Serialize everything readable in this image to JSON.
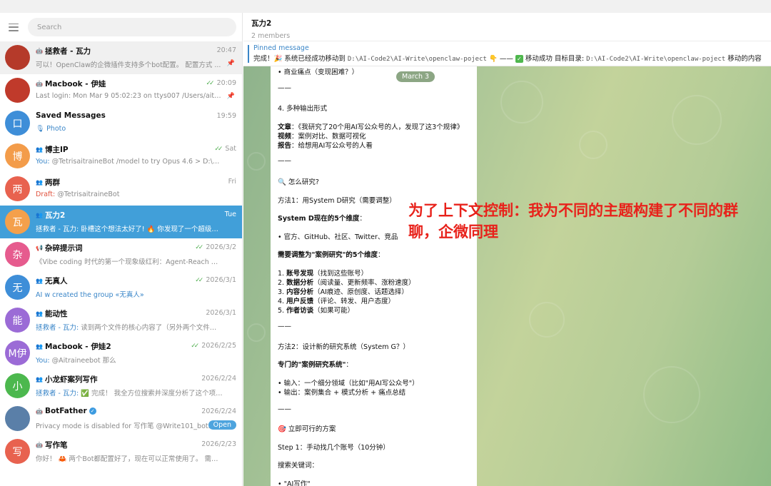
{
  "search": {
    "placeholder": "Search"
  },
  "chats": [
    {
      "name": "拯救者 - 瓦力",
      "time": "20:47",
      "preview": "可以！OpenClaw的企微插件支持多个bot配置。 配置方式 ...",
      "avatar_text": "",
      "avatar_color": "#b53a2a",
      "group_icon": "bot-icon",
      "pinned": true
    },
    {
      "name": "Macbook - 伊娃",
      "time": "20:09",
      "checks": "✓✓",
      "preview": "Last login: Mon Mar  9 05:02:23 on ttys007 /Users/aitraine...",
      "avatar_text": "",
      "avatar_color": "#c03a2b",
      "group_icon": "bot-icon",
      "pinned": true
    },
    {
      "name": "Saved Messages",
      "time": "19:59",
      "preview": "Photo",
      "preview_icon": "🎙",
      "avatar_text": "口",
      "avatar_color": "#3e8ed8"
    },
    {
      "name": "博主IP",
      "time": "Sat",
      "checks": "✓✓",
      "sender": "You:",
      "preview": "@TetrisaitraineBot   /model to try Opus 4.6 > D:\\AI-Code...",
      "avatar_text": "博",
      "avatar_color": "#f39c4a",
      "group_icon": "group-icon"
    },
    {
      "name": "两群",
      "time": "Fri",
      "draft": "Draft:",
      "preview": "@TetrisaitraineBot",
      "avatar_text": "两",
      "avatar_color": "#e8624f",
      "group_icon": "group-icon"
    },
    {
      "name": "瓦力2",
      "time": "Tue",
      "sender": "拯救者 - 瓦力:",
      "preview": "卧槽这个想法太好了! 🔥 你发现了一个超级有价...",
      "avatar_text": "瓦",
      "avatar_color": "#f4a04b",
      "group_icon": "group-icon",
      "active": true
    },
    {
      "name": "杂碎提示词",
      "time": "2026/3/2",
      "checks": "✓✓",
      "preview": "《Vibe coding 时代的第一个现象级红利：Agent-Reach 爆火背后...",
      "avatar_text": "杂",
      "avatar_color": "#e65b8e",
      "group_icon": "channel-icon"
    },
    {
      "name": "无真人",
      "time": "2026/3/1",
      "checks": "✓✓",
      "sender": "AI w created the group «无真人»",
      "preview": "",
      "avatar_text": "无",
      "avatar_color": "#3e8ed8",
      "group_icon": "group-icon"
    },
    {
      "name": "能动性",
      "time": "2026/3/1",
      "sender": "拯救者 - 瓦力:",
      "preview": "读到两个文件的核心内容了（另外两个文件路径不...",
      "avatar_text": "能",
      "avatar_color": "#9b6bd6",
      "group_icon": "group-icon"
    },
    {
      "name": "Macbook - 伊娃2",
      "time": "2026/2/25",
      "checks": "✓✓",
      "sender": "You:",
      "preview": "@Aitraineebot 那么",
      "avatar_text": "M伊",
      "avatar_color": "#9b6bd6",
      "group_icon": "group-icon"
    },
    {
      "name": "小龙虾案列写作",
      "time": "2026/2/24",
      "sender": "拯救者 - 瓦力:",
      "preview": "✅ 完成！ 我全方位搜索并深度分析了这个项目, ...",
      "avatar_text": "小",
      "avatar_color": "#4cb84e",
      "group_icon": "group-icon"
    },
    {
      "name": "BotFather",
      "time": "2026/2/24",
      "preview": "Privacy mode is disabled for 写作笔 @Write101_bot.",
      "avatar_text": "",
      "avatar_color": "#5a7fa8",
      "group_icon": "bot-icon",
      "verified": true,
      "open_label": "Open"
    },
    {
      "name": "写作笔",
      "time": "2026/2/23",
      "preview": "你好！ 🦀 两个Bot都配置好了，现在可以正常使用了。 需要我帮...",
      "avatar_text": "写",
      "avatar_color": "#e8624f",
      "group_icon": "bot-icon"
    }
  ],
  "header": {
    "title": "瓦力2",
    "members": "2 members"
  },
  "pinned": {
    "label": "Pinned message",
    "text_a": "完成！🎉 系统已经成功移动到 ",
    "path_a": "D:\\AI-Code2\\AI-Write\\openclaw-poject",
    "text_b": " 👇 —— ",
    "text_c": " 移动成功 目标目录: ",
    "path_b": "D:\\AI-Code2\\AI-Write\\openclaw-poject",
    "text_d": " 移动的内容"
  },
  "date_chip": "March 3",
  "message": {
    "l01": "• 商业痛点（变现困难？）",
    "l02": "——",
    "l03": "4. 多种输出形式",
    "l04a": "文章",
    "l04b": "：《我研究了20个用AI写公众号的人，发现了这3个规律》",
    "l05a": "视频",
    "l05b": "：案例对比、数据可视化",
    "l06a": "报告",
    "l06b": "：给想用AI写公众号的人看",
    "l07": "——",
    "l08": "🔍 怎么研究?",
    "l09": "方法1：用System D研究（需要调整）",
    "l10": "System D现在的5个维度",
    "l10b": "：",
    "l11": "• 官方、GitHub、社区、Twitter、竞品",
    "l12": "需要调整为\"案例研究\"的5个维度",
    "l12b": "：",
    "l13a": "1. ",
    "l13b": "账号发现",
    "l13c": "（找到这些账号）",
    "l14a": "2. ",
    "l14b": "数据分析",
    "l14c": "（阅读量、更新频率、涨粉速度）",
    "l15a": "3. ",
    "l15b": "内容分析",
    "l15c": "（AI痕迹、原创度、话题选择）",
    "l16a": "4. ",
    "l16b": "用户反馈",
    "l16c": "（评论、转发、用户态度）",
    "l17a": "5. ",
    "l17b": "作者访谈",
    "l17c": "（如果可能）",
    "l18": "——",
    "l19": "方法2：设计新的研究系统（System G？）",
    "l20": "专门的\"案例研究系统\"",
    "l20b": "：",
    "l21": "• 输入：一个细分领域（比如\"用AI写公众号\"）",
    "l22": "• 输出：案例集合 + 模式分析 + 痛点总结",
    "l23": "——",
    "l24": "🎯 立即可行的方案",
    "l25": "Step 1：手动找几个账号（10分钟）",
    "l26": "搜索关键词：",
    "l27": "• \"AI写作\""
  },
  "overlay": "为了上下文控制：我为不同的主题构建了不同的群聊，企微同理"
}
